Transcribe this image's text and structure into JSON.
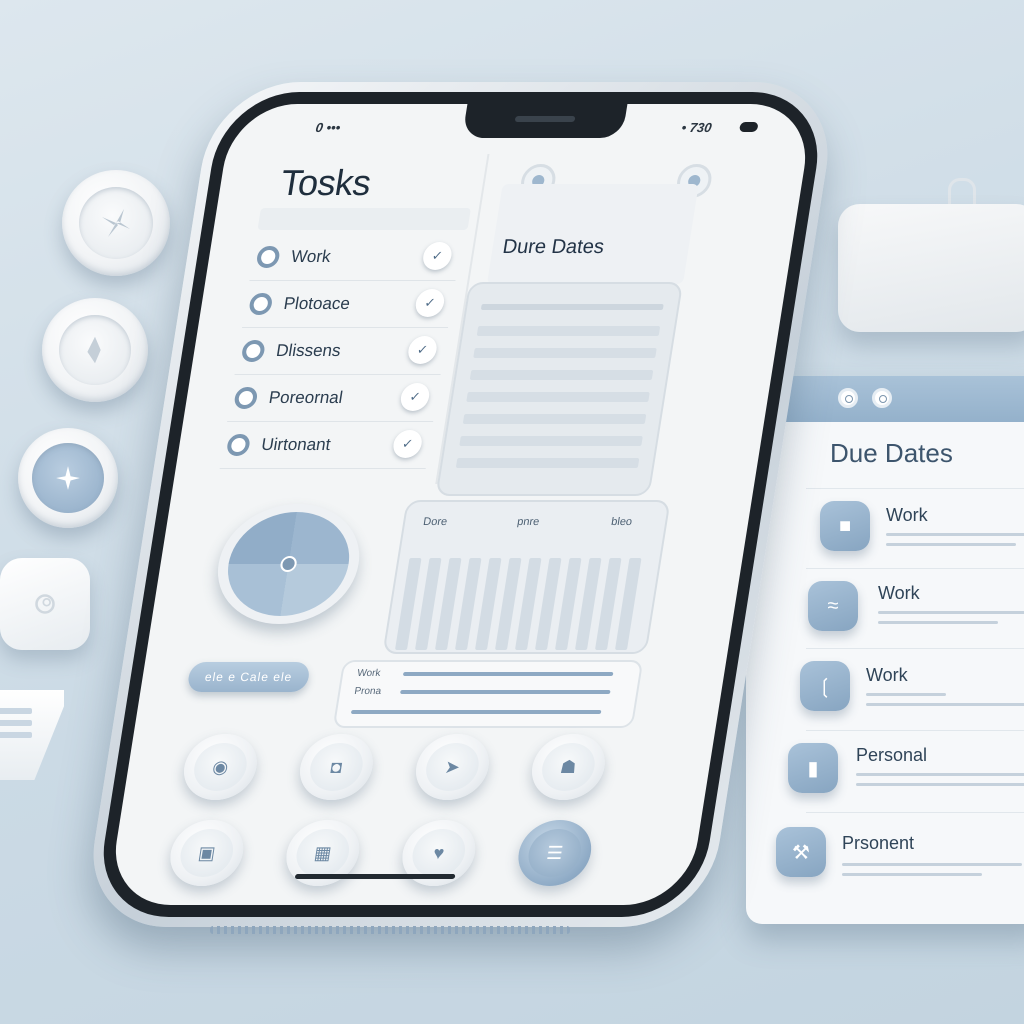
{
  "phone": {
    "status_left": "0 •••",
    "status_right": "• 730",
    "tasks_title": "Tosks",
    "task_header_left": "",
    "task_header_right": "",
    "tasks": [
      {
        "label": "Work",
        "check": "✓"
      },
      {
        "label": "Plotoace",
        "check": "✓"
      },
      {
        "label": "Dlissens",
        "check": "✓"
      },
      {
        "label": "Poreornal",
        "check": "✓"
      },
      {
        "label": "Uirtonant",
        "check": "✓"
      }
    ],
    "due_card_small_left": "",
    "due_card_small_right": "",
    "due_title": "Dure Dates",
    "chart_columns": [
      "Dore",
      "pnre",
      "bleo"
    ],
    "line_items": [
      "Work",
      "Prona"
    ],
    "pill_label": "ele e  Cale ele"
  },
  "tag": {
    "line1": "",
    "line2": ""
  },
  "panel": {
    "title": "Due Dates",
    "rows": [
      {
        "label": "Work"
      },
      {
        "label": "Work"
      },
      {
        "label": "Work"
      },
      {
        "label": "Personal"
      },
      {
        "label": "Prsonent"
      }
    ]
  },
  "colors": {
    "accent": "#94b1cb",
    "bezel": "#1d2329",
    "screen": "#f3f5f6"
  },
  "icons": {
    "deco": [
      "flower-icon",
      "star-icon",
      "sparkle-icon",
      "swirl-icon"
    ],
    "panel_rows": [
      "square-icon",
      "wave-icon",
      "bracket-icon",
      "bar-icon",
      "tool-icon"
    ],
    "controls": [
      "eye-icon",
      "chat-icon",
      "cursor-icon",
      "chair-icon",
      "book-icon",
      "box-icon",
      "heart-icon",
      "menu-icon"
    ]
  }
}
